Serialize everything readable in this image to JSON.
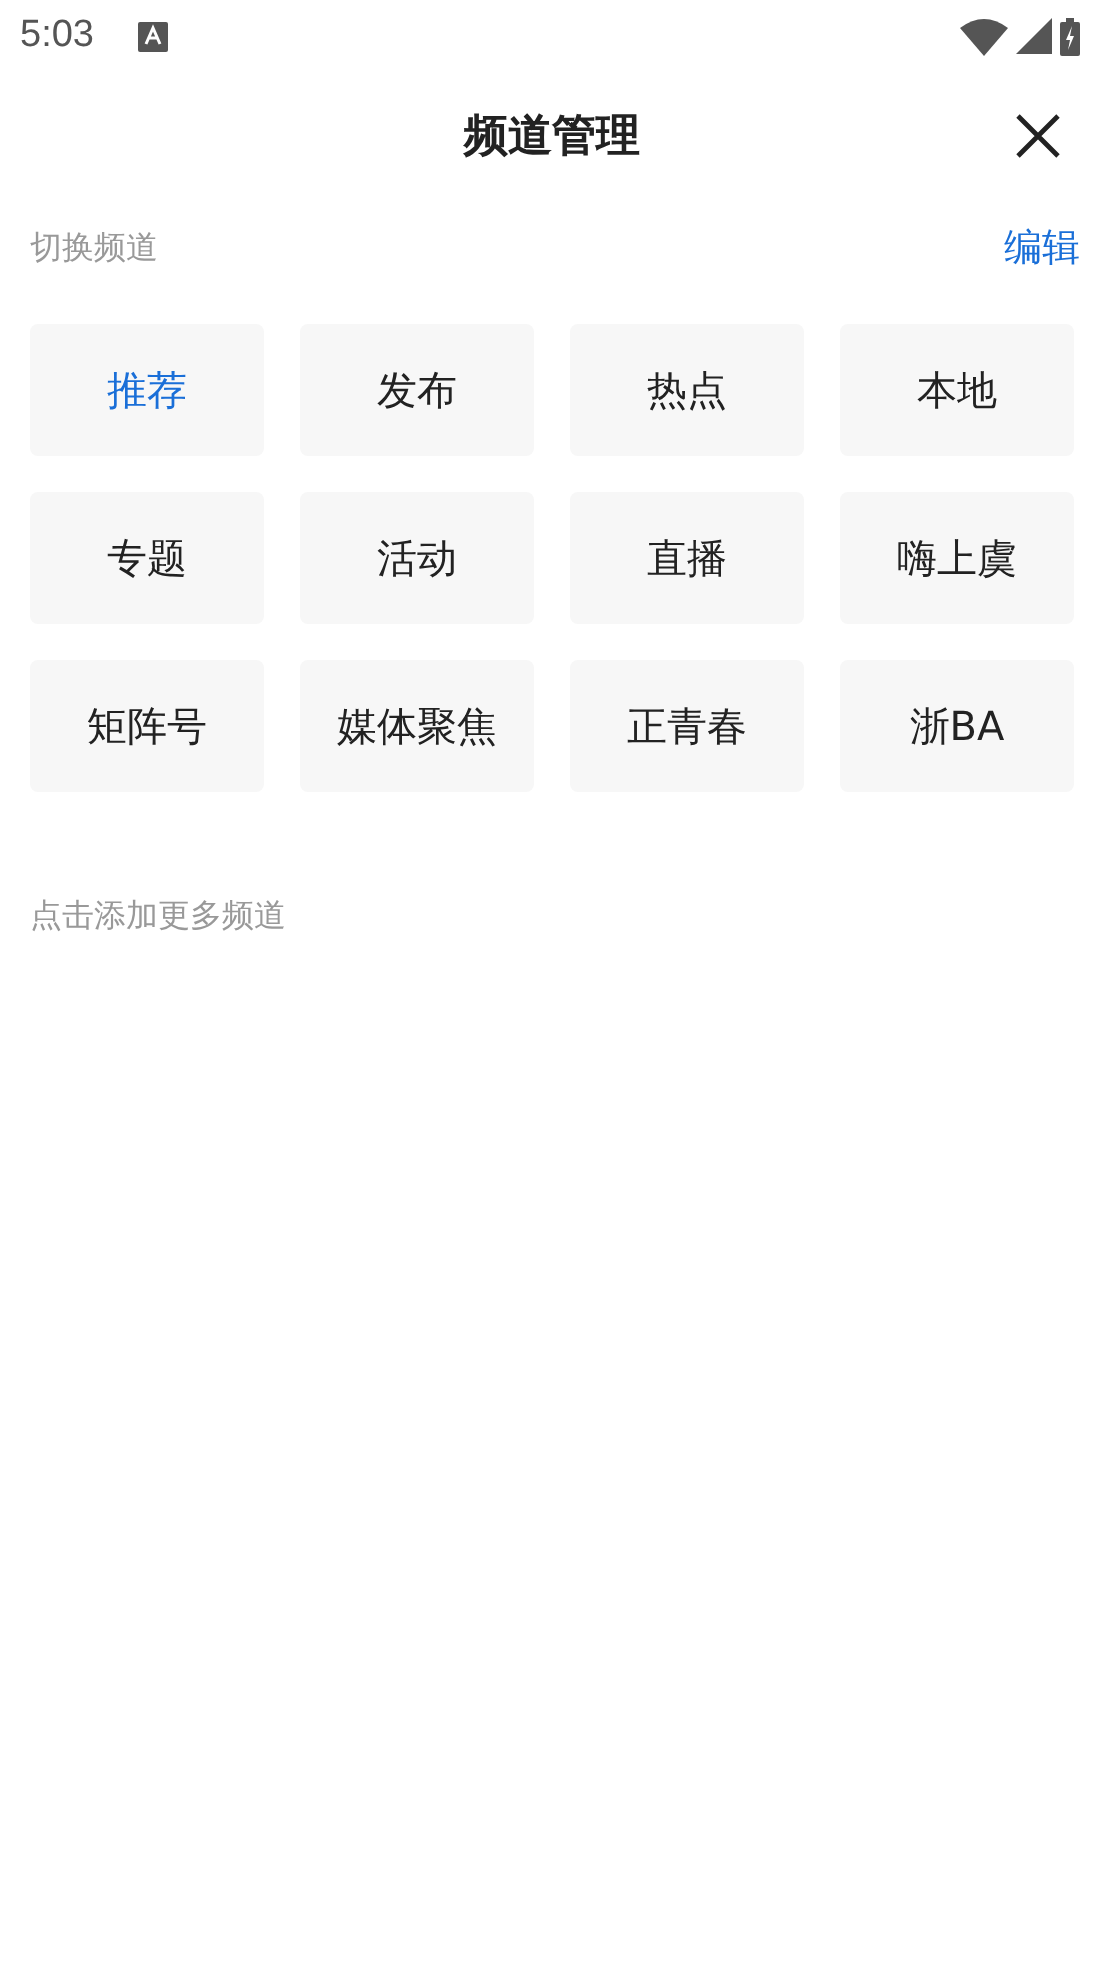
{
  "status_bar": {
    "time": "5:03"
  },
  "header": {
    "title": "频道管理"
  },
  "section": {
    "title": "切换频道",
    "action": "编辑"
  },
  "channels": [
    {
      "label": "推荐",
      "selected": true
    },
    {
      "label": "发布",
      "selected": false
    },
    {
      "label": "热点",
      "selected": false
    },
    {
      "label": "本地",
      "selected": false
    },
    {
      "label": "专题",
      "selected": false
    },
    {
      "label": "活动",
      "selected": false
    },
    {
      "label": "直播",
      "selected": false
    },
    {
      "label": "嗨上虞",
      "selected": false
    },
    {
      "label": "矩阵号",
      "selected": false
    },
    {
      "label": "媒体聚焦",
      "selected": false
    },
    {
      "label": "正青春",
      "selected": false
    },
    {
      "label": "浙BA",
      "selected": false
    }
  ],
  "more_hint": "点击添加更多频道"
}
